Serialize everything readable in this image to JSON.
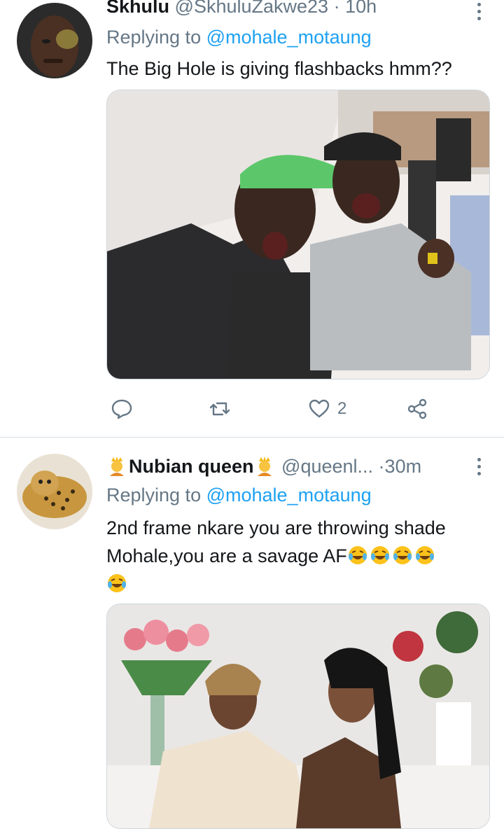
{
  "tweets": [
    {
      "name": "Skhulu",
      "handle": "@SkhuluZakwe23",
      "dot": "·",
      "time": "10h",
      "reply_prefix": "Replying to ",
      "reply_mention": "@mohale_motaung",
      "text": "The Big Hole is giving flashbacks hmm??",
      "likes": "2",
      "media_alt": "Two elderly men in a tent laughing with missing teeth"
    },
    {
      "name": "Nubian queen",
      "handle": "@queenl...",
      "dot": "·",
      "time": "30m",
      "reply_prefix": "Replying to ",
      "reply_mention": "@mohale_motaung",
      "text_line1": "2nd frame nkare you are throwing shade",
      "text_line2": "Mohale,you are a savage AF",
      "media_alt": "Two women sitting together laughing beside flowers"
    }
  ],
  "icons": [
    "comment-icon",
    "retweet-icon",
    "like-icon",
    "share-icon",
    "more-icon",
    "laughing-emoji",
    "princess-emoji"
  ],
  "colors": {
    "accent": "#1da1f2",
    "muted": "#657786",
    "text": "#14171a",
    "divider": "#d9dee2",
    "emoji": "#fcc21b"
  }
}
